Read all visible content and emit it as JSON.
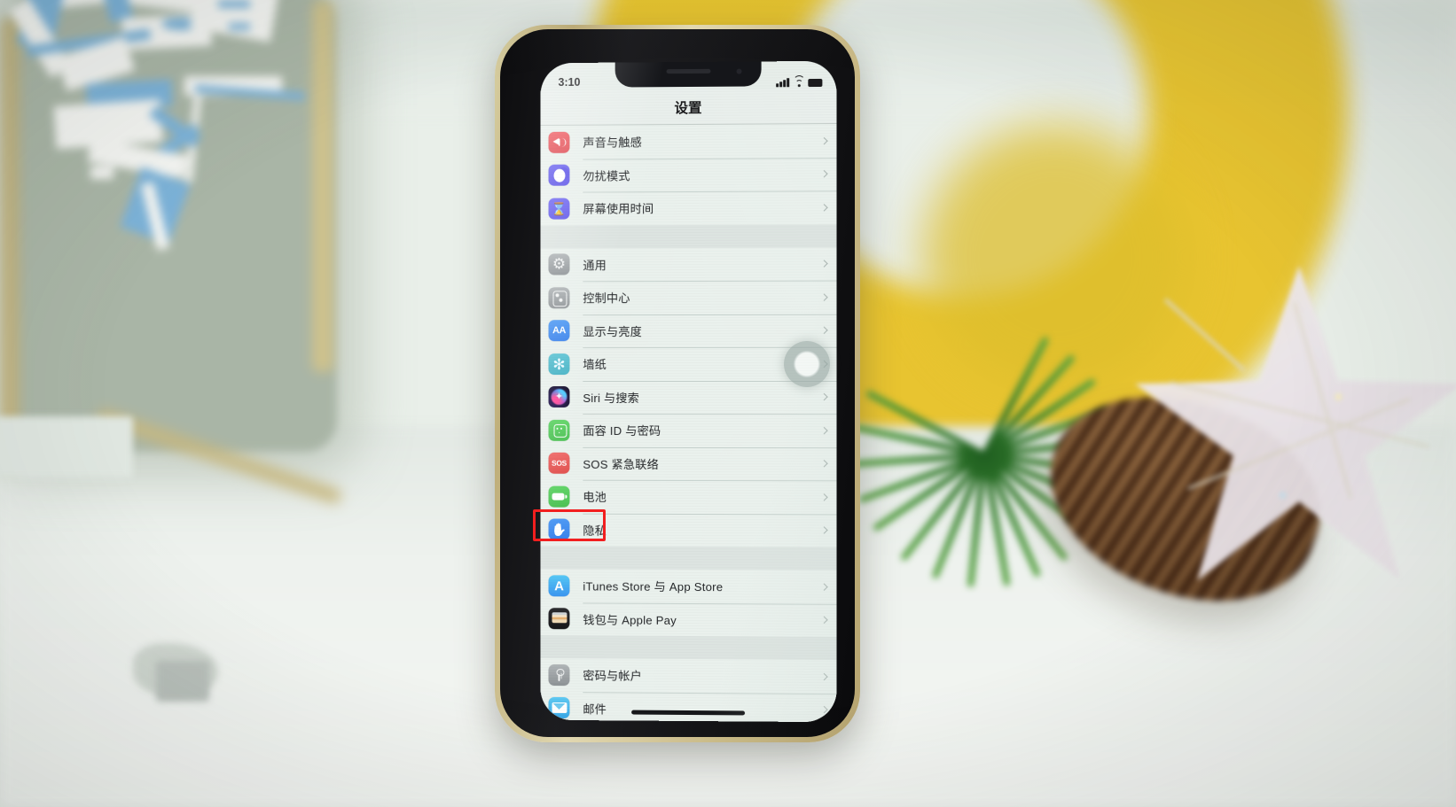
{
  "scene": {
    "description": "iPhone X photographed on a white table with Christmas decorations, displaying the iOS Settings list in Chinese"
  },
  "phone": {
    "status_bar": {
      "time": "3:10",
      "signal_icon": "cellular-bars-icon",
      "wifi_icon": "wifi-icon",
      "battery_icon": "battery-full-icon"
    },
    "nav": {
      "title": "设置"
    },
    "home_indicator": "home-indicator"
  },
  "settings": {
    "groups": [
      {
        "id": "group-notifications",
        "rows": [
          {
            "label": "声音与触感",
            "icon": "sound-haptics-icon",
            "icon_class": "ic-sound",
            "name": "settings-row-sound-haptics"
          },
          {
            "label": "勿扰模式",
            "icon": "do-not-disturb-icon",
            "icon_class": "ic-dnd",
            "name": "settings-row-do-not-disturb"
          },
          {
            "label": "屏幕使用时间",
            "icon": "screen-time-icon",
            "icon_class": "ic-screen",
            "name": "settings-row-screen-time"
          }
        ]
      },
      {
        "id": "group-system",
        "rows": [
          {
            "label": "通用",
            "icon": "gear-icon",
            "icon_class": "ic-general",
            "name": "settings-row-general"
          },
          {
            "label": "控制中心",
            "icon": "control-center-icon",
            "icon_class": "ic-control",
            "name": "settings-row-control-center"
          },
          {
            "label": "显示与亮度",
            "icon": "display-brightness-icon",
            "icon_class": "ic-display",
            "name": "settings-row-display-brightness"
          },
          {
            "label": "墙纸",
            "icon": "wallpaper-icon",
            "icon_class": "ic-wall",
            "name": "settings-row-wallpaper"
          },
          {
            "label": "Siri 与搜索",
            "icon": "siri-icon",
            "icon_class": "ic-siri",
            "name": "settings-row-siri-search"
          },
          {
            "label": "面容 ID 与密码",
            "icon": "face-id-icon",
            "icon_class": "ic-faceid",
            "name": "settings-row-face-id-passcode"
          },
          {
            "label": "SOS 紧急联络",
            "icon": "emergency-sos-icon",
            "icon_class": "ic-sos",
            "name": "settings-row-emergency-sos"
          },
          {
            "label": "电池",
            "icon": "battery-icon",
            "icon_class": "ic-batt",
            "name": "settings-row-battery"
          },
          {
            "label": "隐私",
            "icon": "privacy-hand-icon",
            "icon_class": "ic-privacy",
            "name": "settings-row-privacy"
          }
        ]
      },
      {
        "id": "group-stores",
        "rows": [
          {
            "label": "iTunes Store 与 App Store",
            "icon": "app-store-icon",
            "icon_class": "ic-appstore",
            "name": "settings-row-itunes-app-store"
          },
          {
            "label": "钱包与 Apple Pay",
            "icon": "wallet-icon",
            "icon_class": "ic-wallet",
            "name": "settings-row-wallet-apple-pay"
          }
        ]
      },
      {
        "id": "group-accounts",
        "rows": [
          {
            "label": "密码与帐户",
            "icon": "key-icon",
            "icon_class": "ic-pass",
            "name": "settings-row-passwords-accounts"
          },
          {
            "label": "邮件",
            "icon": "mail-icon",
            "icon_class": "ic-mail",
            "name": "settings-row-mail"
          }
        ]
      }
    ]
  },
  "annotations": {
    "highlight": {
      "target_label": "隐私",
      "color": "#f21f1f",
      "name": "privacy-row-highlight"
    },
    "touch_indicator": {
      "name": "touch-indicator",
      "color": "#8c9b96"
    }
  },
  "colors": {
    "screen_bg": "#eaf1ed",
    "group_gap": "#dde4e1",
    "separator": "#96a8a2",
    "label_text": "#25272a",
    "phone_frame_gold": "#c6b785",
    "highlight_red": "#f21f1f"
  }
}
